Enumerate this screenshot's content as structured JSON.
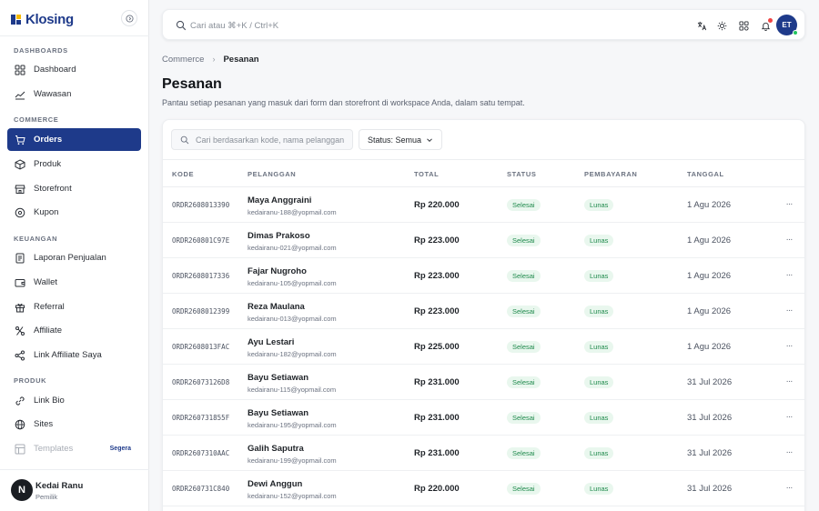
{
  "brand": {
    "name": "Klosing"
  },
  "sidebar": {
    "sections": [
      {
        "label": "DASHBOARDS"
      },
      {
        "label": "COMMERCE"
      },
      {
        "label": "KEUANGAN"
      },
      {
        "label": "PRODUK"
      }
    ],
    "items": [
      {
        "label": "Dashboard",
        "icon": "grid-icon"
      },
      {
        "label": "Wawasan",
        "icon": "chart-line-icon"
      },
      {
        "label": "Orders",
        "icon": "cart-icon"
      },
      {
        "label": "Produk",
        "icon": "box-icon"
      },
      {
        "label": "Storefront",
        "icon": "store-icon"
      },
      {
        "label": "Kupon",
        "icon": "coupon-icon"
      },
      {
        "label": "Laporan Penjualan",
        "icon": "report-icon"
      },
      {
        "label": "Wallet",
        "icon": "wallet-icon"
      },
      {
        "label": "Referral",
        "icon": "gift-icon"
      },
      {
        "label": "Affiliate",
        "icon": "affiliate-icon"
      },
      {
        "label": "Link Affiliate Saya",
        "icon": "share-icon"
      },
      {
        "label": "Link Bio",
        "icon": "link-icon"
      },
      {
        "label": "Sites",
        "icon": "globe-icon"
      },
      {
        "label": "Templates",
        "icon": "template-icon",
        "badge": "Segera"
      }
    ],
    "active_item": "Orders",
    "user": {
      "initial": "N",
      "name": "Kedai Ranu",
      "role": "Pemilik"
    }
  },
  "topbar": {
    "search_placeholder": "Cari atau ⌘+K / Ctrl+K",
    "avatar_initials": "ET"
  },
  "breadcrumb": {
    "parent": "Commerce",
    "separator": "›",
    "current": "Pesanan"
  },
  "page": {
    "title": "Pesanan",
    "subtitle": "Pantau setiap pesanan yang masuk dari form dan storefront di workspace Anda, dalam satu tempat."
  },
  "filters": {
    "search_placeholder": "Cari berdasarkan kode, nama pelanggan",
    "status_label": "Status: Semua"
  },
  "table": {
    "columns": [
      "KODE",
      "PELANGGAN",
      "TOTAL",
      "STATUS",
      "PEMBAYARAN",
      "TANGGAL"
    ],
    "rows": [
      {
        "code": "ORDR2608013390",
        "name": "Maya Anggraini",
        "email": "kedairanu-188@yopmail.com",
        "total": "Rp 220.000",
        "status": "Selesai",
        "payment": "Lunas",
        "date": "1 Agu 2026"
      },
      {
        "code": "ORDR260801C97E",
        "name": "Dimas Prakoso",
        "email": "kedairanu-021@yopmail.com",
        "total": "Rp 223.000",
        "status": "Selesai",
        "payment": "Lunas",
        "date": "1 Agu 2026"
      },
      {
        "code": "ORDR2608017336",
        "name": "Fajar Nugroho",
        "email": "kedairanu-105@yopmail.com",
        "total": "Rp 223.000",
        "status": "Selesai",
        "payment": "Lunas",
        "date": "1 Agu 2026"
      },
      {
        "code": "ORDR2608012399",
        "name": "Reza Maulana",
        "email": "kedairanu-013@yopmail.com",
        "total": "Rp 223.000",
        "status": "Selesai",
        "payment": "Lunas",
        "date": "1 Agu 2026"
      },
      {
        "code": "ORDR2608013FAC",
        "name": "Ayu Lestari",
        "email": "kedairanu-182@yopmail.com",
        "total": "Rp 225.000",
        "status": "Selesai",
        "payment": "Lunas",
        "date": "1 Agu 2026"
      },
      {
        "code": "ORDR26073126D8",
        "name": "Bayu Setiawan",
        "email": "kedairanu-115@yopmail.com",
        "total": "Rp 231.000",
        "status": "Selesai",
        "payment": "Lunas",
        "date": "31 Jul 2026"
      },
      {
        "code": "ORDR260731855F",
        "name": "Bayu Setiawan",
        "email": "kedairanu-195@yopmail.com",
        "total": "Rp 231.000",
        "status": "Selesai",
        "payment": "Lunas",
        "date": "31 Jul 2026"
      },
      {
        "code": "ORDR2607310AAC",
        "name": "Galih Saputra",
        "email": "kedairanu-199@yopmail.com",
        "total": "Rp 231.000",
        "status": "Selesai",
        "payment": "Lunas",
        "date": "31 Jul 2026"
      },
      {
        "code": "ORDR260731C840",
        "name": "Dewi Anggun",
        "email": "kedairanu-152@yopmail.com",
        "total": "Rp 220.000",
        "status": "Selesai",
        "payment": "Lunas",
        "date": "31 Jul 2026"
      }
    ],
    "more_label": "···"
  },
  "colors": {
    "primary": "#1e3a8a",
    "accent": "#f5b800",
    "success_bg": "#e9f7ee",
    "success_text": "#1f8a4c",
    "notification": "#ef4444"
  }
}
